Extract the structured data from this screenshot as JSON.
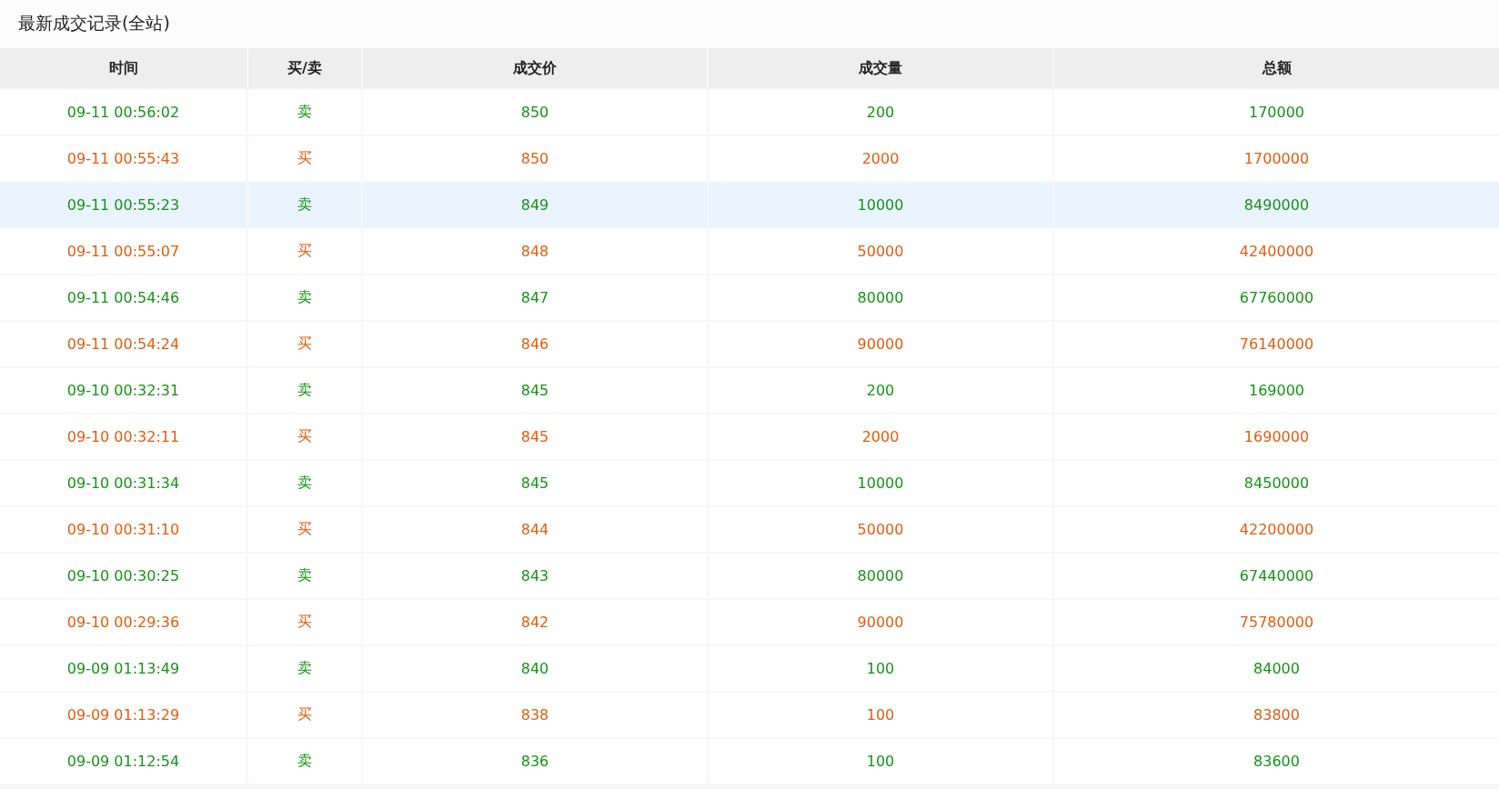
{
  "title": "最新成交记录(全站)",
  "table": {
    "columns": [
      "时间",
      "买/卖",
      "成交价",
      "成交量",
      "总额"
    ],
    "rows": [
      {
        "kind": "sell",
        "time": "09-11 00:56:02",
        "side": "卖",
        "price": "850",
        "volume": "200",
        "total": "170000",
        "selected": false
      },
      {
        "kind": "buy",
        "time": "09-11 00:55:43",
        "side": "买",
        "price": "850",
        "volume": "2000",
        "total": "1700000",
        "selected": false
      },
      {
        "kind": "sell",
        "time": "09-11 00:55:23",
        "side": "卖",
        "price": "849",
        "volume": "10000",
        "total": "8490000",
        "selected": true
      },
      {
        "kind": "buy",
        "time": "09-11 00:55:07",
        "side": "买",
        "price": "848",
        "volume": "50000",
        "total": "42400000",
        "selected": false
      },
      {
        "kind": "sell",
        "time": "09-11 00:54:46",
        "side": "卖",
        "price": "847",
        "volume": "80000",
        "total": "67760000",
        "selected": false
      },
      {
        "kind": "buy",
        "time": "09-11 00:54:24",
        "side": "买",
        "price": "846",
        "volume": "90000",
        "total": "76140000",
        "selected": false
      },
      {
        "kind": "sell",
        "time": "09-10 00:32:31",
        "side": "卖",
        "price": "845",
        "volume": "200",
        "total": "169000",
        "selected": false
      },
      {
        "kind": "buy",
        "time": "09-10 00:32:11",
        "side": "买",
        "price": "845",
        "volume": "2000",
        "total": "1690000",
        "selected": false
      },
      {
        "kind": "sell",
        "time": "09-10 00:31:34",
        "side": "卖",
        "price": "845",
        "volume": "10000",
        "total": "8450000",
        "selected": false
      },
      {
        "kind": "buy",
        "time": "09-10 00:31:10",
        "side": "买",
        "price": "844",
        "volume": "50000",
        "total": "42200000",
        "selected": false
      },
      {
        "kind": "sell",
        "time": "09-10 00:30:25",
        "side": "卖",
        "price": "843",
        "volume": "80000",
        "total": "67440000",
        "selected": false
      },
      {
        "kind": "buy",
        "time": "09-10 00:29:36",
        "side": "买",
        "price": "842",
        "volume": "90000",
        "total": "75780000",
        "selected": false
      },
      {
        "kind": "sell",
        "time": "09-09 01:13:49",
        "side": "卖",
        "price": "840",
        "volume": "100",
        "total": "84000",
        "selected": false
      },
      {
        "kind": "buy",
        "time": "09-09 01:13:29",
        "side": "买",
        "price": "838",
        "volume": "100",
        "total": "83800",
        "selected": false
      },
      {
        "kind": "sell",
        "time": "09-09 01:12:54",
        "side": "卖",
        "price": "836",
        "volume": "100",
        "total": "83600",
        "selected": false
      }
    ]
  }
}
